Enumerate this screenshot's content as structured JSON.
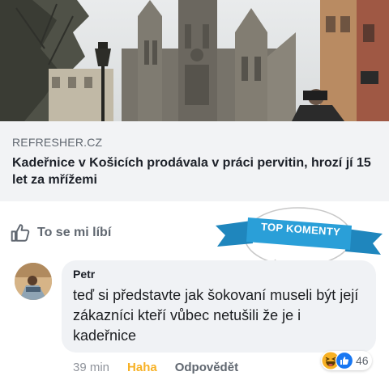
{
  "link_preview": {
    "image_icon": "cathedral-photo",
    "source": "REFRESHER.CZ",
    "title": "Kadeřnice v Košicích prodávala v práci pervitin, hrozí jí 15 let za mřížemi"
  },
  "like_action": {
    "icon": "thumbs-up-icon",
    "label": "To se mi líbí"
  },
  "top_comments_banner": {
    "label": "TOP KOMENTY",
    "color": "#2a9fd8"
  },
  "comment": {
    "author": "Petr",
    "text": "teď si představte jak šokovaní museli být její zákazníci kteří vůbec netušili že je i kadeřnice",
    "time": "39 min",
    "reaction_label": "Haha",
    "reply_label": "Odpovědět",
    "reaction_icons": [
      "haha-emoji-icon",
      "like-reaction-icon"
    ],
    "reaction_count": "46"
  },
  "colors": {
    "card_bg": "#f2f3f5",
    "bubble_bg": "#f0f2f5",
    "haha": "#f7b125",
    "like_blue": "#1877f2"
  }
}
